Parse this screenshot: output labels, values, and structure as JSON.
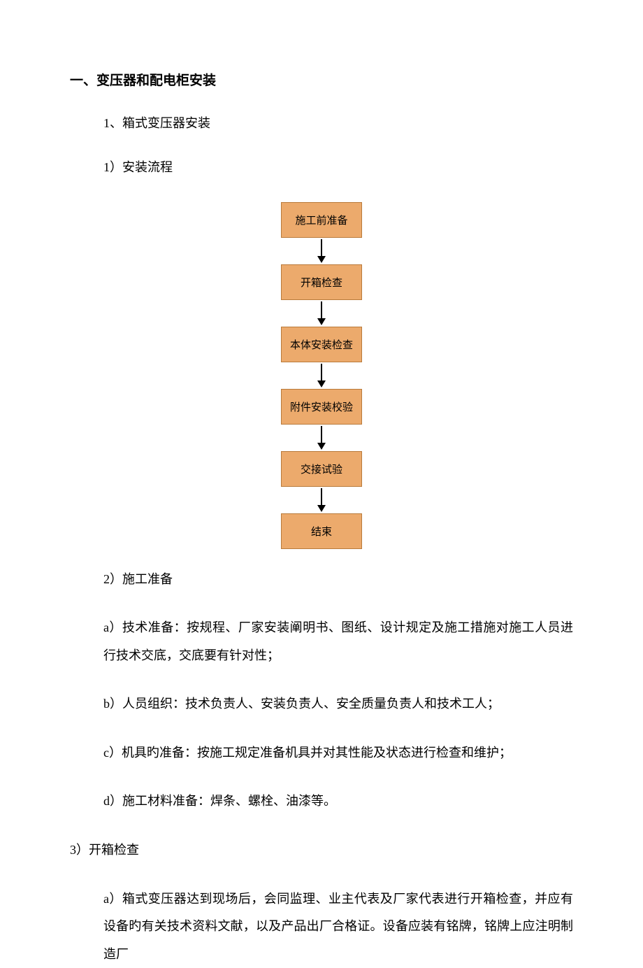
{
  "heading": "一、变压器和配电柜安装",
  "item1": "1、箱式变压器安装",
  "item1_1": "1）安装流程",
  "flow": {
    "steps": [
      "施工前准备",
      "开箱检查",
      "本体安装检查",
      "附件安装校验",
      "交接试验",
      "结束"
    ]
  },
  "item1_2": "2）施工准备",
  "para_a": "a）技术准备：按规程、厂家安装阐明书、图纸、设计规定及施工措施对施工人员进行技术交底，交底要有针对性；",
  "para_b": "b）人员组织：技术负责人、安装负责人、安全质量负责人和技术工人；",
  "para_c": "c）机具旳准备：按施工规定准备机具并对其性能及状态进行检查和维护；",
  "para_d": "d）施工材料准备：焊条、螺栓、油漆等。",
  "item1_3": "3）开箱检查",
  "para_e": "a）箱式变压器达到现场后，会同监理、业主代表及厂家代表进行开箱检查，并应有设备旳有关技术资料文献，以及产品出厂合格证。设备应装有铭牌，铭牌上应注明制造厂"
}
